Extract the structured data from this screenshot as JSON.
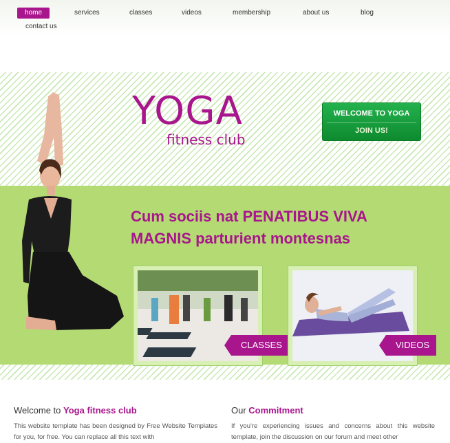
{
  "nav": {
    "items": [
      "home",
      "services",
      "classes",
      "videos",
      "membership",
      "about us",
      "blog",
      "contact us"
    ],
    "active": "home"
  },
  "hero": {
    "logo_title": "YOGA",
    "logo_subtitle": "fitness club",
    "cta_welcome": "WELCOME TO YOGA",
    "cta_join": "JOIN US!",
    "headline_line1": "Cum sociis nat PENATIBUS VIVA",
    "headline_line2": "MAGNIS parturient montesnas",
    "cards": [
      {
        "label": "CLASSES"
      },
      {
        "label": "VIDEOS"
      }
    ]
  },
  "welcome": {
    "prefix": "Welcome to ",
    "highlight": "Yoga fitness club",
    "text": "This website template has been designed by Free Website Templates for you, for free. You can replace all this text with"
  },
  "commitment": {
    "prefix": "Our ",
    "highlight": "Commitment",
    "text": "If you're experiencing issues and concerns about this website template, join the discussion on our forum and meet other"
  },
  "colors": {
    "accent": "#a8158c",
    "green_button": "#1a9e3d",
    "band": "#b4da74"
  }
}
